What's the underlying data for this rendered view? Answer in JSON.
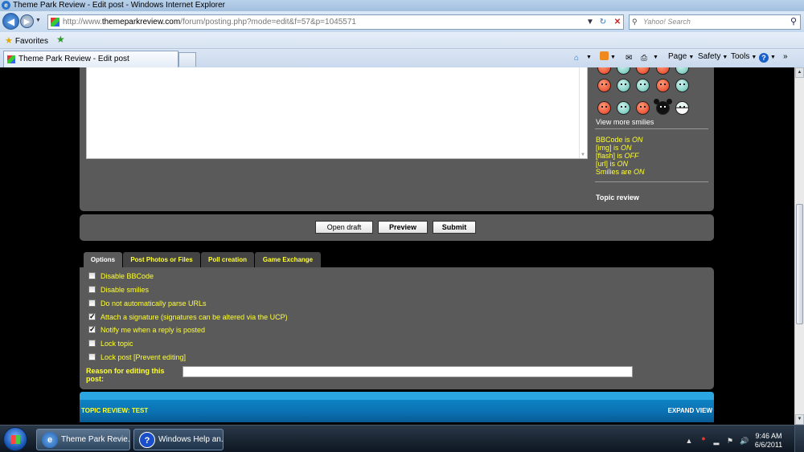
{
  "window": {
    "title": "Theme Park Review - Edit post - Windows Internet Explorer"
  },
  "address_bar": {
    "prefix": "http://www.",
    "domain": "themeparkreview.com",
    "path": "/forum/posting.php?mode=edit&f=57&p=1045571"
  },
  "search": {
    "placeholder": "Yahoo! Search"
  },
  "favorites_bar": {
    "label": "Favorites"
  },
  "tab": {
    "title": "Theme Park Review - Edit post"
  },
  "command_bar": {
    "page": "Page",
    "safety": "Safety",
    "tools": "Tools"
  },
  "editor": {
    "view_more_smilies": "View more smilies",
    "bbcode": {
      "label": "BBCode",
      "is": " is ",
      "state": "ON"
    },
    "img": {
      "label": "[img]",
      "is": " is ",
      "state": "ON"
    },
    "flash": {
      "label": "[flash]",
      "is": " is ",
      "state": "OFF"
    },
    "url": {
      "label": "[url]",
      "is": " is ",
      "state": "ON"
    },
    "smilies": {
      "label": "Smilies",
      "is": " are ",
      "state": "ON"
    },
    "topic_review": "Topic review"
  },
  "buttons": {
    "open_draft": "Open draft",
    "preview": "Preview",
    "submit": "Submit"
  },
  "tabs": [
    {
      "label": "Options"
    },
    {
      "label": "Post Photos or Files"
    },
    {
      "label": "Poll creation"
    },
    {
      "label": "Game Exchange"
    }
  ],
  "options": [
    {
      "label": "Disable BBCode",
      "checked": false
    },
    {
      "label": "Disable smilies",
      "checked": false
    },
    {
      "label": "Do not automatically parse URLs",
      "checked": false
    },
    {
      "label": "Attach a signature (signatures can be altered via the UCP)",
      "checked": true
    },
    {
      "label": "Notify me when a reply is posted",
      "checked": true
    },
    {
      "label": "Lock topic",
      "checked": false
    },
    {
      "label": "Lock post [Prevent editing]",
      "checked": false
    }
  ],
  "reason": {
    "label": "Reason for editing this post:",
    "value": ""
  },
  "topic_review_bar": {
    "title": "TOPIC REVIEW: TEST",
    "expand": "EXPAND VIEW"
  },
  "taskbar": {
    "items": [
      {
        "label": "Theme Park Revie..."
      },
      {
        "label": "Windows Help an..."
      }
    ],
    "time": "9:46 AM",
    "date": "6/6/2011"
  },
  "colors": {
    "panel": "#5a5a5a",
    "highlight_text": "#ffff33",
    "review_bar": "#0a6fb0"
  }
}
